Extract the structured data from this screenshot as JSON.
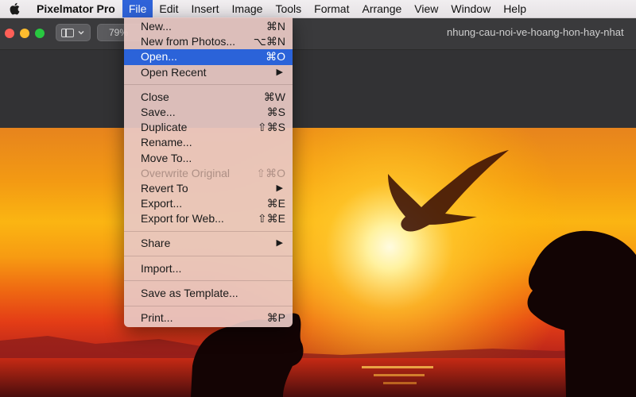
{
  "menubar": {
    "app_name": "Pixelmator Pro",
    "items": [
      "File",
      "Edit",
      "Insert",
      "Image",
      "Tools",
      "Format",
      "Arrange",
      "View",
      "Window",
      "Help"
    ]
  },
  "toolbar": {
    "zoom": "79%",
    "document_title": "nhung-cau-noi-ve-hoang-hon-hay-nhat"
  },
  "file_menu": {
    "new": {
      "label": "New...",
      "shortcut": "⌘N"
    },
    "new_from_photos": {
      "label": "New from Photos...",
      "shortcut": "⌥⌘N"
    },
    "open": {
      "label": "Open...",
      "shortcut": "⌘O"
    },
    "open_recent": {
      "label": "Open Recent",
      "submenu": "▶"
    },
    "close": {
      "label": "Close",
      "shortcut": "⌘W"
    },
    "save": {
      "label": "Save...",
      "shortcut": "⌘S"
    },
    "duplicate": {
      "label": "Duplicate",
      "shortcut": "⇧⌘S"
    },
    "rename": {
      "label": "Rename..."
    },
    "move_to": {
      "label": "Move To..."
    },
    "overwrite_original": {
      "label": "Overwrite Original",
      "shortcut": "⇧⌘O"
    },
    "revert_to": {
      "label": "Revert To",
      "submenu": "▶"
    },
    "export": {
      "label": "Export...",
      "shortcut": "⌘E"
    },
    "export_web": {
      "label": "Export for Web...",
      "shortcut": "⇧⌘E"
    },
    "share": {
      "label": "Share",
      "submenu": "▶"
    },
    "import": {
      "label": "Import..."
    },
    "save_template": {
      "label": "Save as Template..."
    },
    "print": {
      "label": "Print...",
      "shortcut": "⌘P"
    }
  },
  "colors": {
    "menu_highlight": "#2b63d9",
    "close_button": "#ff5f57",
    "minimize_button": "#febc2e",
    "zoom_button": "#28c840"
  }
}
